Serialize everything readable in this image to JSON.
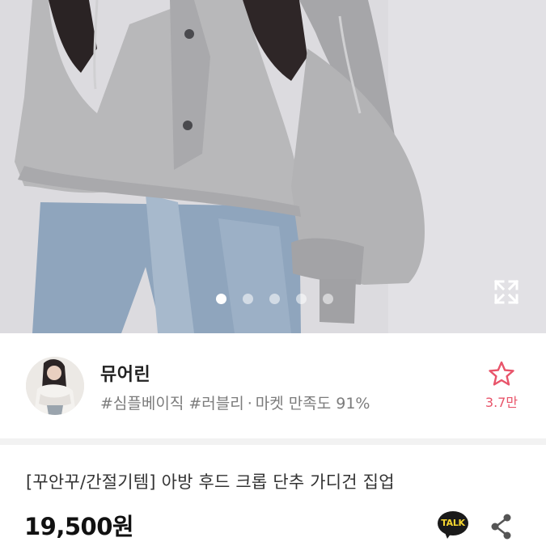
{
  "product_image": {
    "slide_count": 5,
    "active_slide": 1,
    "expand_icon": "expand-arrows-icon"
  },
  "seller": {
    "name": "뮤어린",
    "tags": "#심플베이직 #러블리",
    "separator": "·",
    "satisfaction": "마켓 만족도 91%",
    "favorite_icon": "star-outline-icon",
    "favorite_count": "3.7만"
  },
  "product": {
    "title": "[꾸안꾸/간절기템] 아방 후드 크롭 단추 가디건 집업",
    "price": "19,500원"
  },
  "actions": {
    "talk_label": "TALK",
    "share_icon": "share-icon"
  },
  "colors": {
    "accent": "#e8546a",
    "talk_bubble": "#1a1a1a",
    "talk_text": "#f7d630"
  }
}
